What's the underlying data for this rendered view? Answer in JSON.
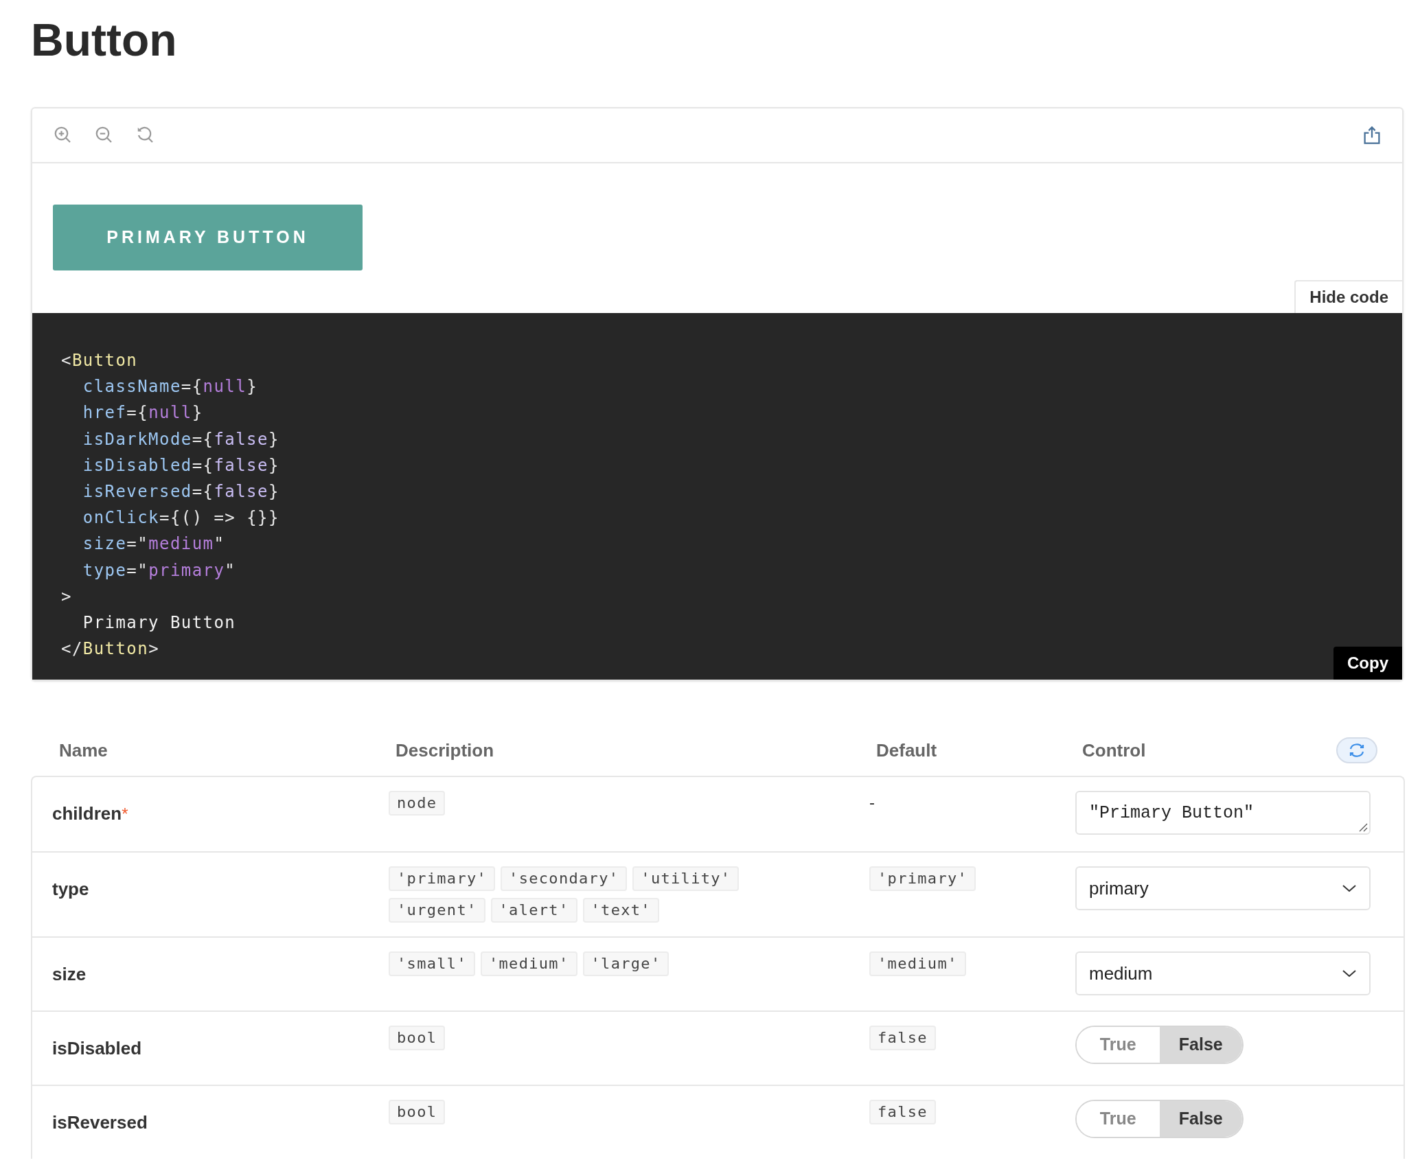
{
  "title": "Button",
  "preview": {
    "button_label": "PRIMARY BUTTON",
    "hide_code_label": "Hide code",
    "copy_label": "Copy"
  },
  "code_lines": [
    {
      "tokens": [
        {
          "text": "<",
          "kind": "punct"
        },
        {
          "text": "Button",
          "kind": "tag"
        }
      ]
    },
    {
      "tokens": [
        {
          "text": "  className",
          "kind": "attr"
        },
        {
          "text": "={",
          "kind": "punct"
        },
        {
          "text": "null",
          "kind": "value"
        },
        {
          "text": "}",
          "kind": "punct"
        }
      ]
    },
    {
      "tokens": [
        {
          "text": "  href",
          "kind": "attr"
        },
        {
          "text": "={",
          "kind": "punct"
        },
        {
          "text": "null",
          "kind": "value"
        },
        {
          "text": "}",
          "kind": "punct"
        }
      ]
    },
    {
      "tokens": [
        {
          "text": "  isDarkMode",
          "kind": "attr"
        },
        {
          "text": "={",
          "kind": "punct"
        },
        {
          "text": "false",
          "kind": "keyword"
        },
        {
          "text": "}",
          "kind": "punct"
        }
      ]
    },
    {
      "tokens": [
        {
          "text": "  isDisabled",
          "kind": "attr"
        },
        {
          "text": "={",
          "kind": "punct"
        },
        {
          "text": "false",
          "kind": "keyword"
        },
        {
          "text": "}",
          "kind": "punct"
        }
      ]
    },
    {
      "tokens": [
        {
          "text": "  isReversed",
          "kind": "attr"
        },
        {
          "text": "={",
          "kind": "punct"
        },
        {
          "text": "false",
          "kind": "keyword"
        },
        {
          "text": "}",
          "kind": "punct"
        }
      ]
    },
    {
      "tokens": [
        {
          "text": "  onClick",
          "kind": "attr"
        },
        {
          "text": "={() => {}}",
          "kind": "punct"
        }
      ]
    },
    {
      "tokens": [
        {
          "text": "  size",
          "kind": "attr"
        },
        {
          "text": "=\"",
          "kind": "punct"
        },
        {
          "text": "medium",
          "kind": "value"
        },
        {
          "text": "\"",
          "kind": "punct"
        }
      ]
    },
    {
      "tokens": [
        {
          "text": "  type",
          "kind": "attr"
        },
        {
          "text": "=\"",
          "kind": "punct"
        },
        {
          "text": "primary",
          "kind": "value"
        },
        {
          "text": "\"",
          "kind": "punct"
        }
      ]
    },
    {
      "tokens": [
        {
          "text": ">",
          "kind": "punct"
        }
      ]
    },
    {
      "tokens": [
        {
          "text": "  Primary Button",
          "kind": "text"
        }
      ]
    },
    {
      "tokens": [
        {
          "text": "</",
          "kind": "punct"
        },
        {
          "text": "Button",
          "kind": "tag"
        },
        {
          "text": ">",
          "kind": "punct"
        }
      ]
    }
  ],
  "table": {
    "columns": [
      "Name",
      "Description",
      "Default",
      "Control"
    ],
    "rows": [
      {
        "name": "children",
        "required_mark": "*",
        "description": [
          "node"
        ],
        "default": {
          "text": "-",
          "kind": "plain"
        },
        "control": {
          "kind": "textarea",
          "value": "\"Primary Button\""
        }
      },
      {
        "name": "type",
        "description": [
          "'primary'",
          "'secondary'",
          "'utility'",
          "'urgent'",
          "'alert'",
          "'text'"
        ],
        "default": {
          "text": "'primary'",
          "kind": "code"
        },
        "control": {
          "kind": "select",
          "value": "primary"
        }
      },
      {
        "name": "size",
        "description": [
          "'small'",
          "'medium'",
          "'large'"
        ],
        "default": {
          "text": "'medium'",
          "kind": "code"
        },
        "control": {
          "kind": "select",
          "value": "medium"
        }
      },
      {
        "name": "isDisabled",
        "description": [
          "bool"
        ],
        "default": {
          "text": "false",
          "kind": "code"
        },
        "control": {
          "kind": "toggle",
          "options": [
            {
              "label": "True",
              "selected": false
            },
            {
              "label": "False",
              "selected": true
            }
          ]
        }
      },
      {
        "name": "isReversed",
        "description": [
          "bool"
        ],
        "default": {
          "text": "false",
          "kind": "code"
        },
        "control": {
          "kind": "toggle",
          "options": [
            {
              "label": "True",
              "selected": false
            },
            {
              "label": "False",
              "selected": true
            }
          ]
        }
      }
    ]
  }
}
